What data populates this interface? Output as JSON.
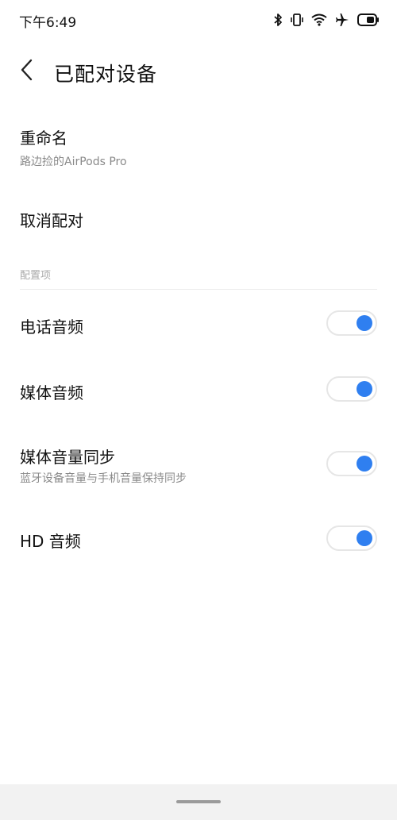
{
  "status_bar": {
    "time": "下午6:49",
    "icons": [
      "bluetooth-icon",
      "vibrate-icon",
      "wifi-icon",
      "airplane-icon",
      "battery-icon"
    ]
  },
  "nav": {
    "back_icon": "chevron-left-icon",
    "title": "已配对设备"
  },
  "rename": {
    "title": "重命名",
    "subtitle": "路边捡的AirPods Pro"
  },
  "unpair": {
    "title": "取消配对"
  },
  "config": {
    "section_header": "配置项",
    "items": [
      {
        "title": "电话音频",
        "subtitle": "",
        "enabled": true
      },
      {
        "title": "媒体音频",
        "subtitle": "",
        "enabled": true
      },
      {
        "title": "媒体音量同步",
        "subtitle": "蓝牙设备音量与手机音量保持同步",
        "enabled": true
      },
      {
        "title": "HD 音频",
        "subtitle": "",
        "enabled": true
      }
    ]
  },
  "colors": {
    "accent": "#2f7ff0",
    "text_primary": "#111111",
    "text_secondary": "#8a8a8a"
  }
}
